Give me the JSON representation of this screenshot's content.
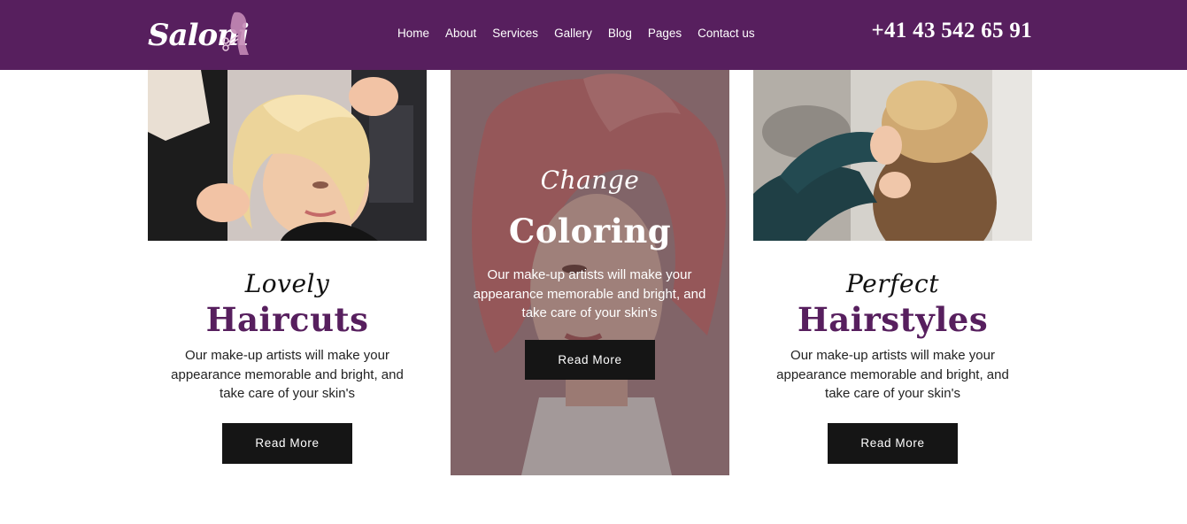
{
  "header": {
    "logo_text": "Saloni",
    "nav": [
      "Home",
      "About",
      "Services",
      "Gallery",
      "Blog",
      "Pages",
      "Contact us"
    ],
    "phone": "+41 43 542 65 91"
  },
  "cards": [
    {
      "script": "Lovely",
      "title": "Haircuts",
      "description": "Our make-up artists will make your appearance memorable and bright, and take care of your skin's",
      "button": "Read More"
    },
    {
      "script": "Change",
      "title": "Coloring",
      "description": "Our make-up artists will make your appearance memorable and bright, and take care of your skin's",
      "button": "Read More"
    },
    {
      "script": "Perfect",
      "title": "Hairstyles",
      "description": "Our make-up artists will make your appearance memorable and bright, and take care of your skin's",
      "button": "Read More"
    }
  ],
  "colors": {
    "brand_purple": "#571f5e",
    "button_black": "#151515",
    "white": "#ffffff"
  }
}
